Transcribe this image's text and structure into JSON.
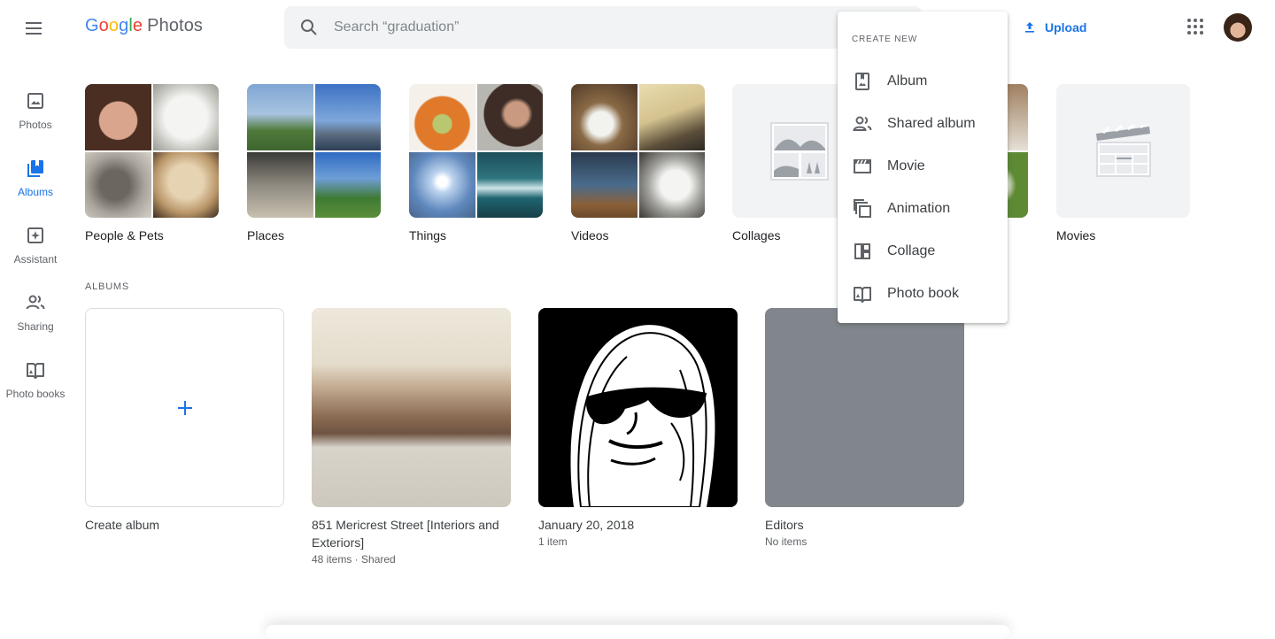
{
  "app": {
    "logo_google": [
      "G",
      "o",
      "o",
      "g",
      "l",
      "e"
    ],
    "logo_product": "Photos"
  },
  "search": {
    "placeholder": "Search “graduation”"
  },
  "header": {
    "upload_label": "Upload"
  },
  "sidebar": {
    "items": [
      {
        "label": "Photos",
        "icon": "photo-icon",
        "active": false
      },
      {
        "label": "Albums",
        "icon": "albums-icon",
        "active": true
      },
      {
        "label": "Assistant",
        "icon": "assistant-icon",
        "active": false
      },
      {
        "label": "Sharing",
        "icon": "sharing-icon",
        "active": false
      },
      {
        "label": "Photo books",
        "icon": "photo-books-icon",
        "active": false
      }
    ]
  },
  "categories": [
    {
      "label": "People & Pets"
    },
    {
      "label": "Places"
    },
    {
      "label": "Things"
    },
    {
      "label": "Videos"
    },
    {
      "label": "Collages"
    },
    {
      "label": ""
    },
    {
      "label": "Movies"
    }
  ],
  "albums_section": {
    "title": "ALBUMS"
  },
  "albums": [
    {
      "title": "Create album",
      "meta": ""
    },
    {
      "title": "851 Mericrest Street [Interiors and Exteriors]",
      "meta": "48 items · Shared"
    },
    {
      "title": "January 20, 2018",
      "meta": "1 item"
    },
    {
      "title": "Editors",
      "meta": "No items"
    }
  ],
  "create_menu": {
    "heading": "CREATE NEW",
    "items": [
      {
        "label": "Album",
        "icon": "album-icon"
      },
      {
        "label": "Shared album",
        "icon": "shared-album-icon"
      },
      {
        "label": "Movie",
        "icon": "movie-icon"
      },
      {
        "label": "Animation",
        "icon": "animation-icon"
      },
      {
        "label": "Collage",
        "icon": "collage-icon"
      },
      {
        "label": "Photo book",
        "icon": "photo-book-icon"
      }
    ]
  },
  "colors": {
    "accent": "#1a73e8",
    "text": "#3c4043",
    "muted": "#5f6368",
    "tile_bg": "#f1f3f4",
    "editors_cover": "#80868b"
  }
}
